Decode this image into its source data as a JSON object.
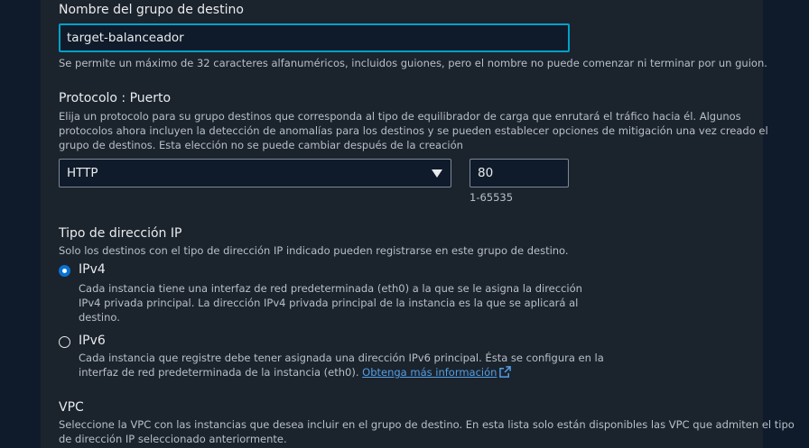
{
  "target_group_name": {
    "label": "Nombre del grupo de destino",
    "value": "target-balanceador",
    "hint": "Se permite un máximo de 32 caracteres alfanuméricos, incluidos guiones, pero el nombre no puede comenzar ni terminar por un guion."
  },
  "protocol_port": {
    "label": "Protocolo : Puerto",
    "description_lines": [
      "Elija un protocolo para su grupo destinos que corresponda al tipo de equilibrador de carga que enrutará el tráfico hacia él. Algunos",
      "protocolos ahora incluyen la detección de anomalías para los destinos y se pueden establecer opciones de mitigación una vez creado el",
      "grupo de destinos. Esta elección no se puede cambiar después de la creación"
    ],
    "protocol_value": "HTTP",
    "port_value": "80",
    "port_hint": "1-65535"
  },
  "ip_address_type": {
    "label": "Tipo de dirección IP",
    "description": "Solo los destinos con el tipo de dirección IP indicado pueden registrarse en este grupo de destino.",
    "options": [
      {
        "label": "IPv4",
        "selected": true,
        "description_lines": [
          "Cada instancia tiene una interfaz de red predeterminada (eth0) a la que se le asigna la dirección",
          "IPv4 privada principal. La dirección IPv4 privada principal de la instancia es la que se aplicará al",
          "destino."
        ]
      },
      {
        "label": "IPv6",
        "selected": false,
        "description_lines": [
          "Cada instancia que registre debe tener asignada una dirección IPv6 principal. Ésta se configura en la",
          "interfaz de red predeterminada de la instancia (eth0)."
        ],
        "link_text": "Obtenga más información"
      }
    ]
  },
  "vpc": {
    "label": "VPC",
    "description_lines": [
      "Seleccione la VPC con las instancias que desea incluir en el grupo de destino. En esta lista solo están disponibles las VPC que admiten el tipo",
      "de dirección IP seleccionado anteriormente."
    ]
  },
  "colors": {
    "background": "#0f1b2a",
    "panel": "#1b232d",
    "focus_border": "#00a1c9",
    "radio_selected": "#0972d3",
    "link": "#539fe5"
  },
  "icons": [
    "external-link-icon",
    "chevron-down-icon"
  ]
}
